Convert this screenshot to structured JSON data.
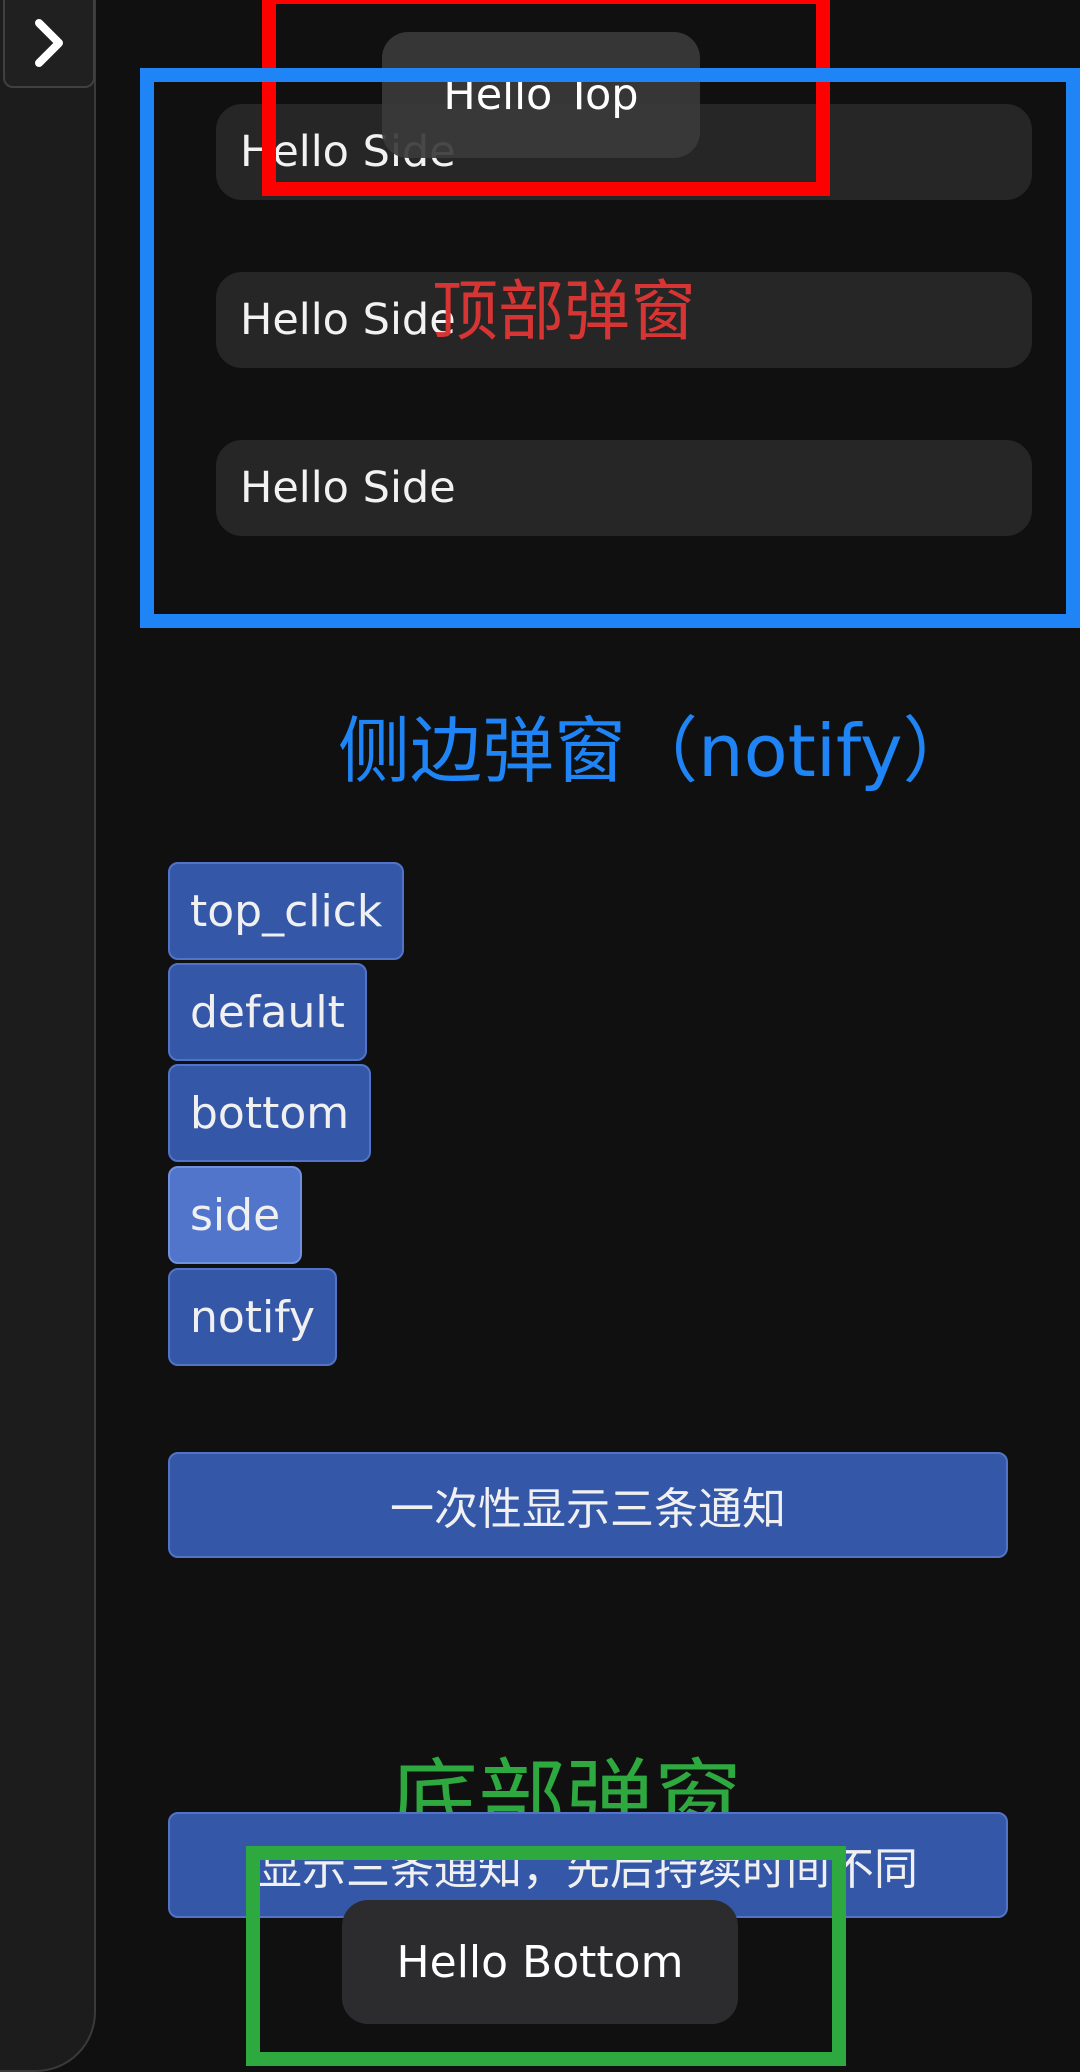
{
  "drawer": {
    "toggle_icon": "chevron-right-icon"
  },
  "side_notifications": [
    "Hello Side",
    "Hello Side",
    "Hello Side"
  ],
  "top_toast": {
    "text": "Hello Top"
  },
  "annotations": {
    "top_label": "顶部弹窗",
    "side_label": "侧边弹窗（notify）",
    "bottom_label": "底部弹窗",
    "colors": {
      "top": "#fd0000",
      "side": "#1f84f5",
      "bottom": "#2ea93f"
    }
  },
  "buttons": [
    {
      "label": "top_click",
      "active": false
    },
    {
      "label": "default",
      "active": false
    },
    {
      "label": "bottom",
      "active": false
    },
    {
      "label": "side",
      "active": true
    },
    {
      "label": "notify",
      "active": false
    }
  ],
  "show_three_button": {
    "label": "一次性显示三条通知"
  },
  "show_three_staggered_button": {
    "label": "显示三条通知，先后持续时间不同"
  },
  "bottom_toast": {
    "text": "Hello Bottom"
  }
}
